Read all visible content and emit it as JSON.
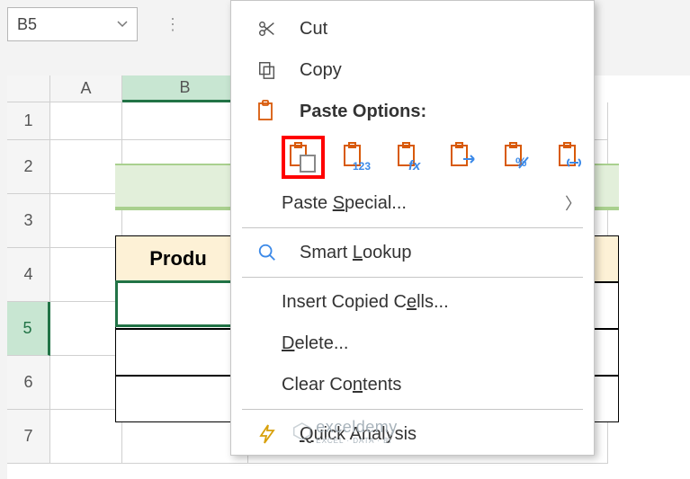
{
  "nameBox": {
    "ref": "B5"
  },
  "columns": {
    "a": "A",
    "b": "B"
  },
  "rows": [
    "1",
    "2",
    "3",
    "4",
    "5",
    "6",
    "7"
  ],
  "table": {
    "hdr_col1": "Produ"
  },
  "menu": {
    "cut": "Cut",
    "copy": "Copy",
    "paste_header": "Paste Options:",
    "paste_special": "Paste Special...",
    "smart_lookup": "Smart Lookup",
    "insert_copied": "Insert Copied Cells...",
    "delete": "Delete...",
    "clear": "Clear Contents",
    "quick_analysis": "Quick Analysis"
  },
  "watermark": {
    "brand": "exceldemy",
    "tag": "EXCEL · DATA · BI"
  }
}
